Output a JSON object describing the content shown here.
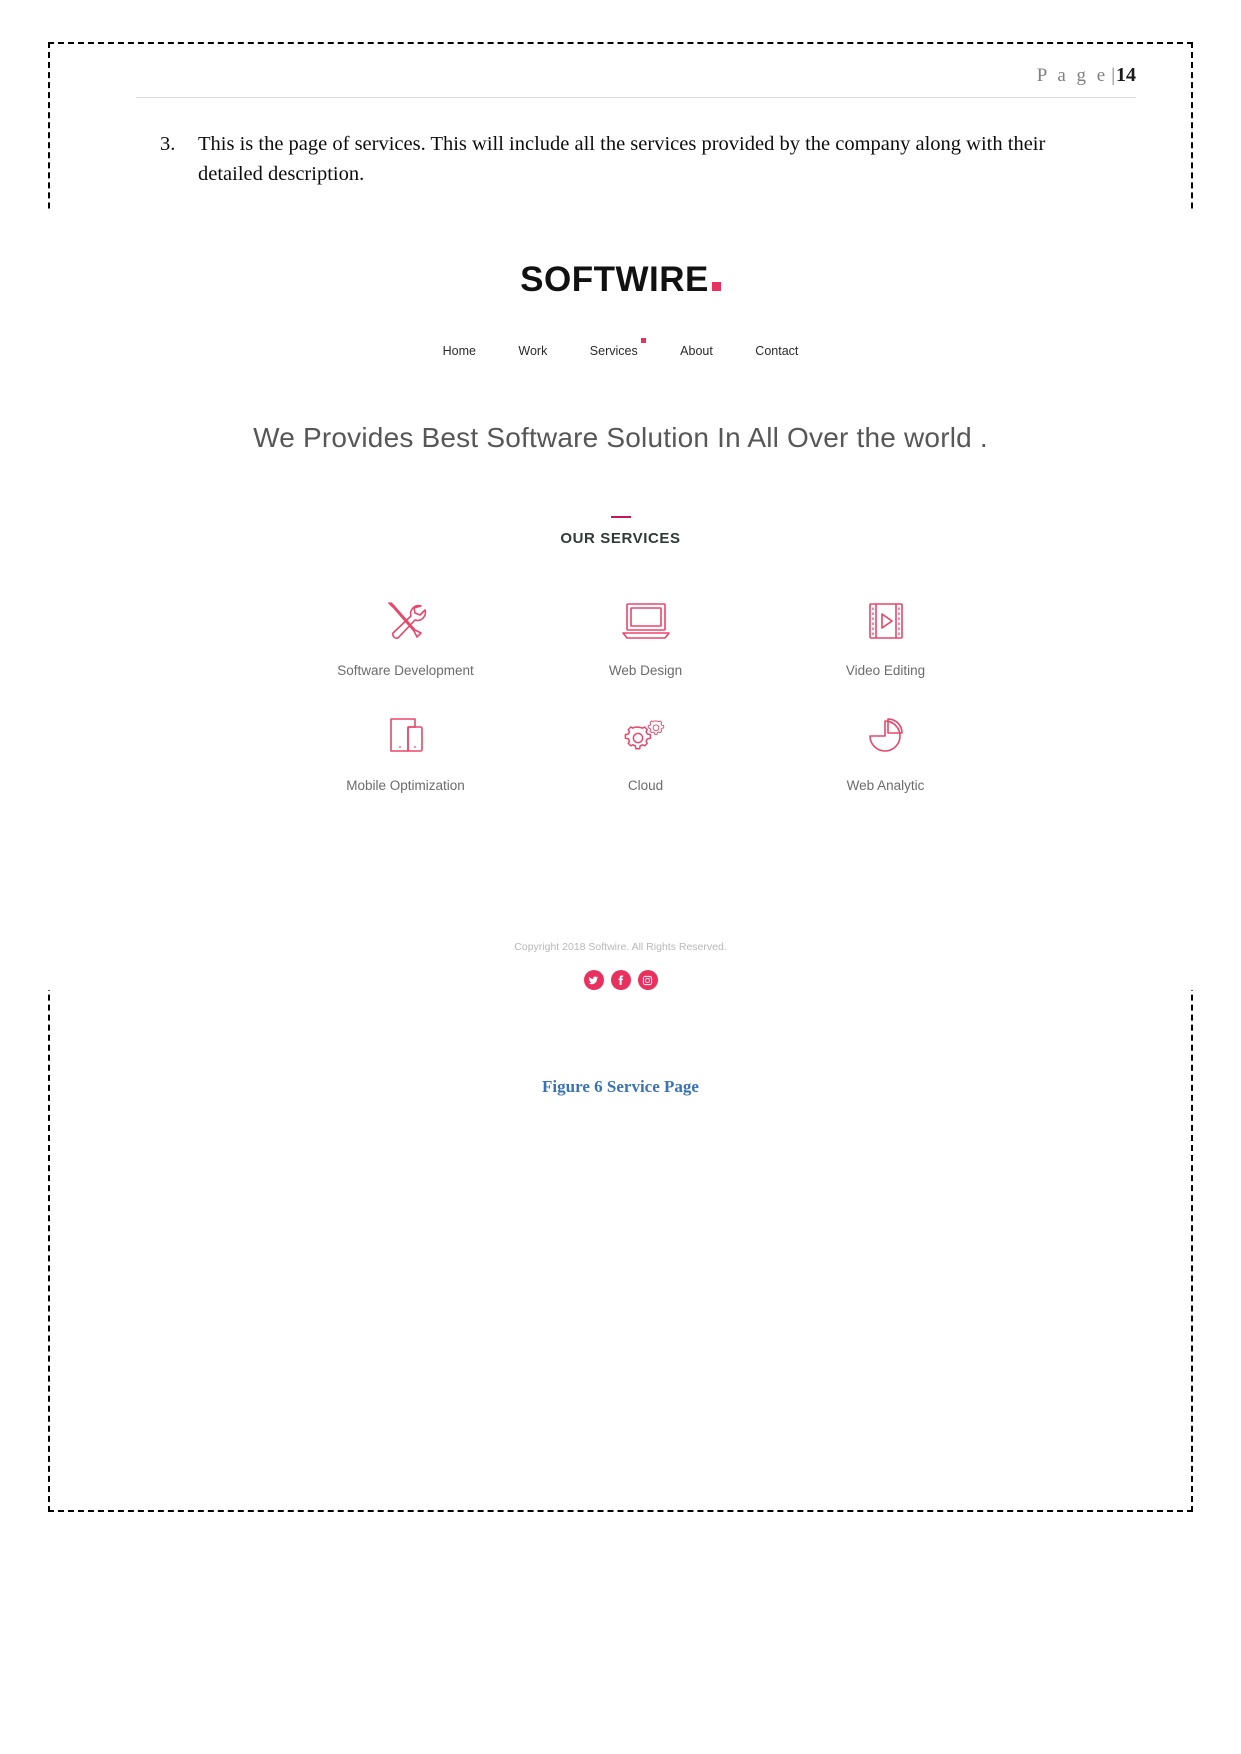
{
  "document": {
    "header": {
      "page_label": "P a g e",
      "separator": "|",
      "page_number": "14"
    },
    "list_item": {
      "number": "3.",
      "text": "This is the page of services. This will include all the services provided by the company along with their detailed description."
    },
    "figure_caption": "Figure 6 Service Page"
  },
  "mock_site": {
    "logo": {
      "text": "SOFTWIRE",
      "accent_color": "#e8315f"
    },
    "nav": [
      {
        "label": "Home",
        "active": false
      },
      {
        "label": "Work",
        "active": false
      },
      {
        "label": "Services",
        "active": true
      },
      {
        "label": "About",
        "active": false
      },
      {
        "label": "Contact",
        "active": false
      }
    ],
    "hero": {
      "headline": "We Provides Best Software Solution In All Over the world ."
    },
    "services_section": {
      "title": "OUR SERVICES",
      "items": [
        {
          "label": "Software Development",
          "icon": "tools-icon"
        },
        {
          "label": "Web Design",
          "icon": "laptop-icon"
        },
        {
          "label": "Video Editing",
          "icon": "film-play-icon"
        },
        {
          "label": "Mobile Optimization",
          "icon": "devices-icon"
        },
        {
          "label": "Cloud",
          "icon": "gears-icon"
        },
        {
          "label": "Web Analytic",
          "icon": "pie-chart-icon"
        }
      ]
    },
    "footer": {
      "copyright": "Copyright 2018 Softwire. All Rights Reserved.",
      "social": [
        {
          "name": "twitter-icon"
        },
        {
          "name": "facebook-icon"
        },
        {
          "name": "instagram-icon"
        }
      ]
    },
    "colors": {
      "accent": "#e8315f",
      "icon_stroke": "#e8476b",
      "caption_blue": "#3b72b5"
    }
  }
}
